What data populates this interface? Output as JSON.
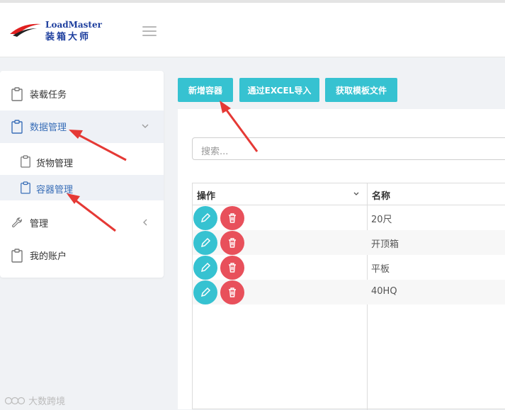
{
  "brand": {
    "name_en": "LoadMaster",
    "name_cn": "装箱大师"
  },
  "sidebar": {
    "items": [
      {
        "label": "装载任务",
        "icon": "clipboard-icon"
      },
      {
        "label": "数据管理",
        "icon": "clipboard-icon",
        "expanded": true
      },
      {
        "label": "货物管理",
        "icon": "clipboard-icon",
        "sub": true
      },
      {
        "label": "容器管理",
        "icon": "clipboard-icon",
        "sub": true,
        "selected": true
      },
      {
        "label": "管理",
        "icon": "wrench-icon",
        "expanded": false
      },
      {
        "label": "我的账户",
        "icon": "clipboard-icon"
      }
    ]
  },
  "toolbar": {
    "add_label": "新增容器",
    "import_label": "通过EXCEL导入",
    "template_label": "获取模板文件"
  },
  "search": {
    "placeholder": "搜索..."
  },
  "table": {
    "columns": [
      "操作",
      "名称"
    ],
    "rows": [
      {
        "name": "20尺"
      },
      {
        "name": "开顶箱"
      },
      {
        "name": "平板"
      },
      {
        "name": "40HQ"
      }
    ]
  },
  "colors": {
    "accent": "#36c2d1",
    "danger": "#e8505b",
    "annotation": "#e53935",
    "active_text": "#3a6fb8"
  },
  "watermark": "大数跨境"
}
